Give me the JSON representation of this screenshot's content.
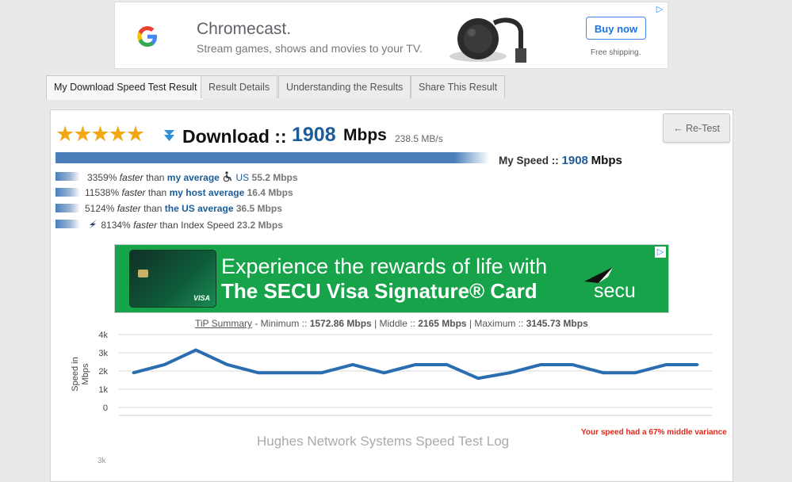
{
  "ad_top": {
    "title": "Chromecast.",
    "subtitle": "Stream games, shows and movies to your TV.",
    "button": "Buy now",
    "shipping": "Free shipping."
  },
  "tabs": [
    {
      "label": "My Download Speed Test Result",
      "active": true
    },
    {
      "label": "Result Details",
      "active": false
    },
    {
      "label": "Understanding the Results",
      "active": false
    },
    {
      "label": "Share This Result",
      "active": false
    }
  ],
  "result": {
    "stars": "★★★★★",
    "download_label": "Download ::",
    "speed_value": "1908",
    "speed_unit": "Mbps",
    "mb_per_s": "238.5 MB/s",
    "retest_label": "← Re-Test",
    "my_speed_label": "My Speed ::",
    "my_speed_value": "1908",
    "my_speed_unit": "Mbps"
  },
  "comparisons": [
    {
      "pct": "3359%",
      "faster": "faster",
      "than": "than",
      "target": "my average",
      "loc": "US",
      "value": "55.2 Mbps"
    },
    {
      "pct": "11538%",
      "faster": "faster",
      "than": "than",
      "target": "my host average",
      "value": "16.4 Mbps"
    },
    {
      "pct": "5124%",
      "faster": "faster",
      "than": "than",
      "target": "the US average",
      "value": "36.5 Mbps"
    },
    {
      "pct": "8134%",
      "faster": "faster",
      "than": "than Index Speed",
      "value": "23.2 Mbps"
    }
  ],
  "ad_secu": {
    "line1": "Experience the rewards of life with",
    "line2": "The SECU Visa Signature® Card",
    "brand": "secu",
    "card_brand": "VISA"
  },
  "tip": {
    "label": "TiP Summary",
    "min_label": " - Minimum :: ",
    "min": "1572.86 Mbps",
    "mid_label": " | Middle :: ",
    "mid": "2165 Mbps",
    "max_label": " | Maximum :: ",
    "max": "3145.73 Mbps"
  },
  "variance_text": "Your speed had a 67% middle variance",
  "log_title": "Hughes Network Systems Speed Test Log",
  "lower_tick": "3k",
  "colors": {
    "accent_blue": "#1c5d99",
    "bar_blue": "#4a7fbb",
    "line_blue": "#2a6db0",
    "star_gold": "#f2a714",
    "secu_green": "#16a34a",
    "variance_red": "#e0281c"
  },
  "chart_data": {
    "type": "line",
    "ylabel": "Speed in Mbps",
    "ylim": [
      0,
      4000
    ],
    "yticks": [
      "0",
      "1k",
      "2k",
      "3k",
      "4k"
    ],
    "grid": true,
    "series": [
      {
        "values": [
          1900,
          2350,
          3150,
          2350,
          1900,
          1900,
          1900,
          2350,
          1900,
          2350,
          2350,
          1600,
          1900,
          2350,
          2350,
          1900,
          1900,
          2350,
          2350
        ]
      }
    ]
  }
}
